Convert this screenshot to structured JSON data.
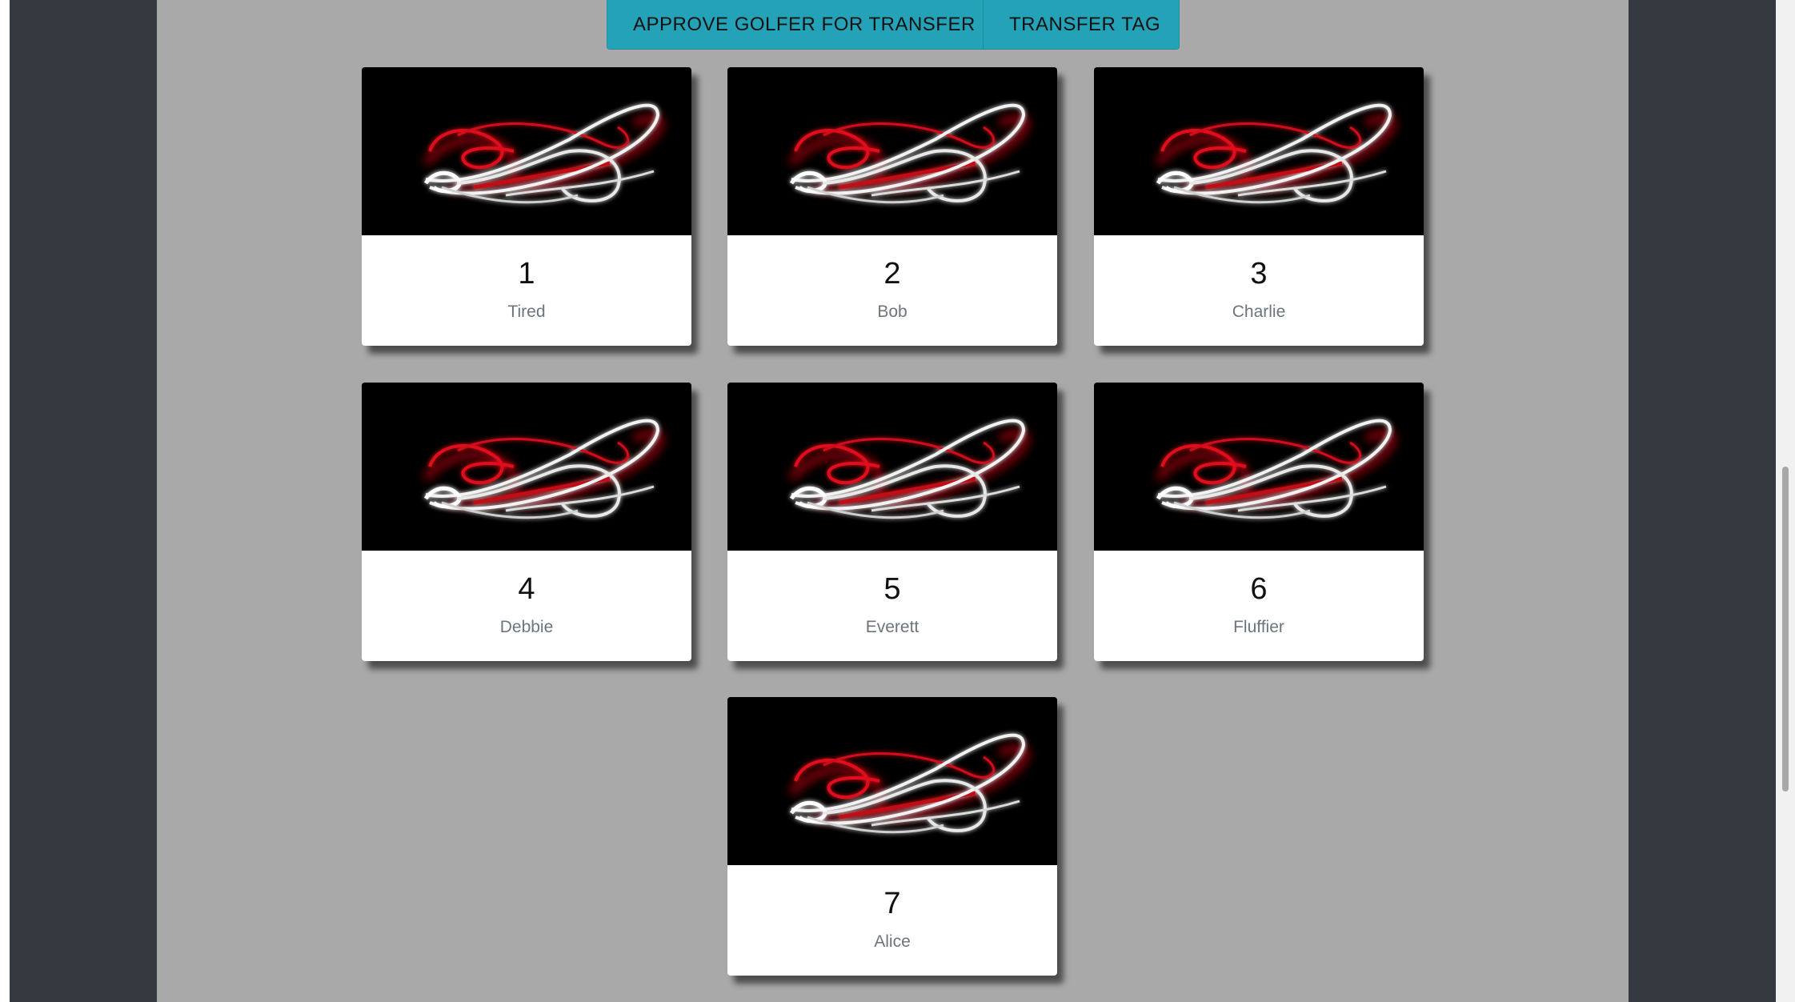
{
  "toolbar": {
    "approve_label": "APPROVE GOLFER FOR TRANSFER",
    "transfer_label": "TRANSFER TAG"
  },
  "cards": [
    {
      "number": "1",
      "name": "Tired"
    },
    {
      "number": "2",
      "name": "Bob"
    },
    {
      "number": "3",
      "name": "Charlie"
    },
    {
      "number": "4",
      "name": "Debbie"
    },
    {
      "number": "5",
      "name": "Everett"
    },
    {
      "number": "6",
      "name": "Fluffier"
    },
    {
      "number": "7",
      "name": "Alice"
    }
  ],
  "colors": {
    "page_background": "#343a40",
    "content_background": "#a9a9a9",
    "button_color": "#23a2b8",
    "card_background": "#ffffff",
    "muted_text": "#6c757d"
  },
  "icons": {
    "card_image": "light-trail-image"
  }
}
